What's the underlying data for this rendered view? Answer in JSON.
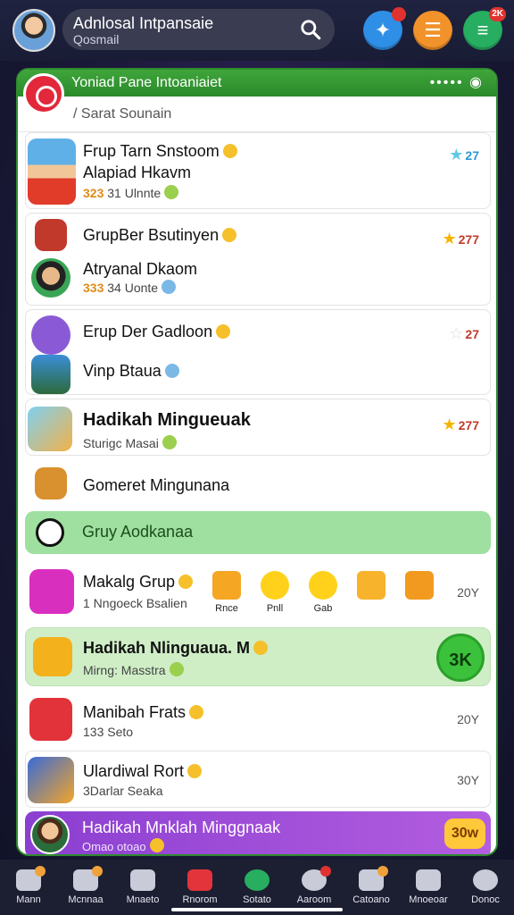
{
  "header": {
    "title": "Adnlosal Intpansaie",
    "subtitle": "Qosmail",
    "badge_orange_count": "",
    "badge_green_count": "2K",
    "colors": {
      "blue": "#2f8fe6",
      "orange": "#f2922a",
      "green": "#27ae60"
    }
  },
  "panel": {
    "title": "Yoniad Pane Intoaniaiet",
    "dots": "••••• ◉",
    "search_placeholder": "/ Sarat Sounain"
  },
  "list": [
    {
      "name": "Frup Tarn Snstoom",
      "name2": "Alapiad Hkavm",
      "meta_num": "323",
      "meta": "31 Ulnnte",
      "rating": "27"
    },
    {
      "name": "GrupBer Bsutinyen",
      "name2": "Atryanal Dkaom",
      "meta_num": "333",
      "meta": "34 Uonte",
      "rating": "277"
    },
    {
      "name": "Erup Der Gadloon",
      "name2": "Vinp Btaua",
      "rating": "27"
    },
    {
      "name": "Hadikah Mingueuak",
      "meta": "Sturigc Masai",
      "rating": "277"
    },
    {
      "name": "Gomeret Mingunana"
    }
  ],
  "group_bar": {
    "label": "Gruy Aodkanaa"
  },
  "makaln": {
    "name": "Makalg Grup",
    "meta": "1 Nngoeck Bsalien",
    "rewards": [
      "Rnce",
      "Pnll",
      "Gab",
      "",
      ""
    ],
    "count": "20Y"
  },
  "highlight": {
    "name": "Hadikah Nlinguaua. M",
    "meta": "Mirng: Masstra",
    "pill": "3K"
  },
  "rows2": [
    {
      "name": "Manibah Frats",
      "meta": "133 Seto",
      "count": "20Y"
    },
    {
      "name": "Ulardiwal Rort",
      "meta": "3Darlar Seaka",
      "count": "30Y"
    }
  ],
  "purple": {
    "name": "Hadikah Mnklah Minggnaak",
    "meta": "Omao otoao",
    "tag": "30w"
  },
  "nav": [
    "Mann",
    "Mcnnaa",
    "Mnaeto",
    "Rnorom",
    "Sotato",
    "Aaroom",
    "Catoano",
    "Mnoeoar",
    "Donoc"
  ]
}
